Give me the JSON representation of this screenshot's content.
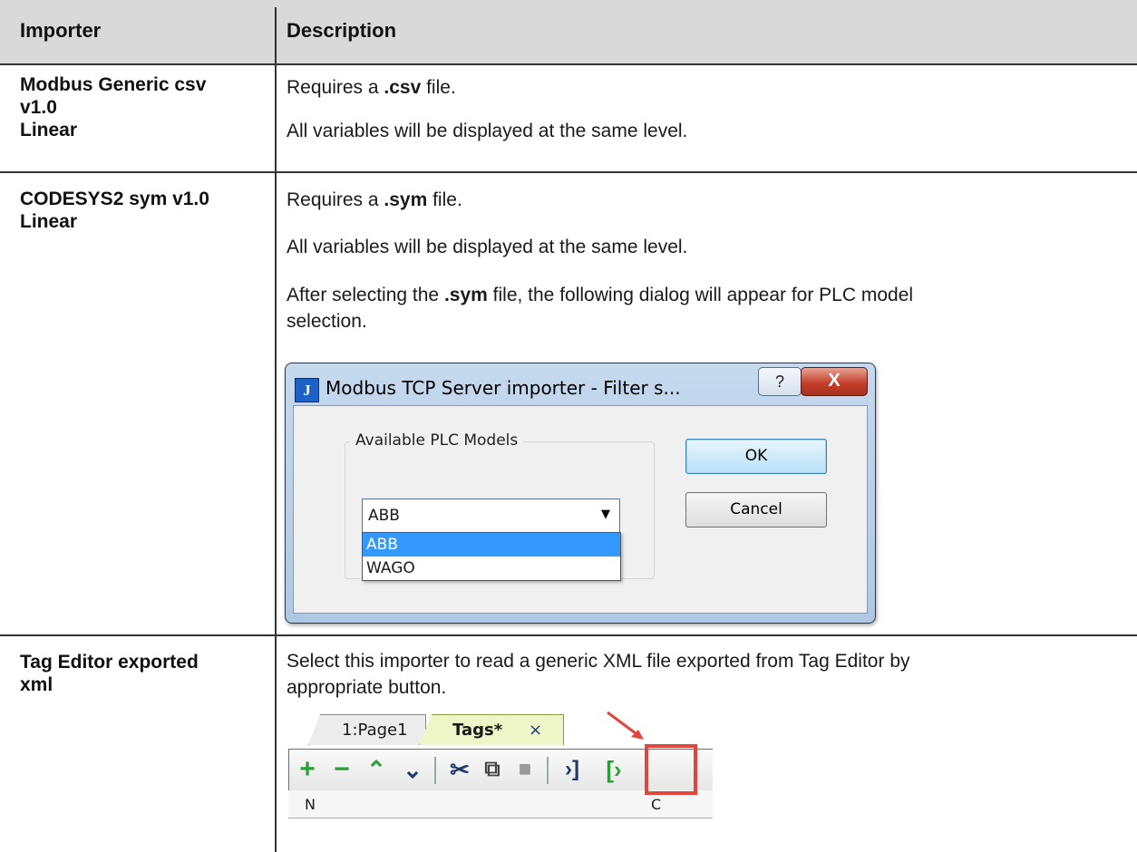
{
  "table": {
    "headers": {
      "importer": "Importer",
      "description": "Description"
    },
    "rows": [
      {
        "importer_lines": [
          "Modbus Generic csv",
          "v1.0",
          "Linear"
        ],
        "desc": [
          {
            "pre": "Requires a ",
            "bold": ".csv",
            "post": " file."
          },
          {
            "text": "All variables will be displayed at the same level."
          }
        ]
      },
      {
        "importer_lines": [
          "CODESYS2 sym v1.0",
          "Linear"
        ],
        "desc": [
          {
            "pre": "Requires a ",
            "bold": ".sym",
            "post": " file."
          },
          {
            "text": "All variables will be displayed at the same level."
          },
          {
            "pre": "After selecting the ",
            "bold": ".sym",
            "post": " file, the following dialog will appear for PLC model",
            "line2": "selection."
          }
        ]
      },
      {
        "importer_lines": [
          "Tag Editor exported",
          "xml"
        ],
        "desc": [
          {
            "text": "Select this importer to read a generic XML file exported from Tag Editor by",
            "line2": "appropriate button."
          }
        ]
      }
    ]
  },
  "dialog": {
    "icon_text": "J",
    "title": "Modbus TCP Server importer - Filter s...",
    "help_glyph": "?",
    "close_glyph": "X",
    "group_label": "Available PLC Models",
    "combo_value": "ABB",
    "dropdown_options": [
      "ABB",
      "WAGO"
    ],
    "selected_option": "ABB",
    "ok_label": "OK",
    "cancel_label": "Cancel"
  },
  "tag_editor": {
    "tabs": [
      {
        "label": "1:Page1"
      },
      {
        "label": "Tags*",
        "close": "×"
      }
    ],
    "toolbar_icons": [
      "add-icon",
      "remove-icon",
      "move-up-icon",
      "move-down-icon",
      "cut-icon",
      "copy-icon",
      "paste-icon",
      "import-icon",
      "export-icon"
    ],
    "grid_header_fragment": "N",
    "grid_header_fragment_right": "C",
    "colors": {
      "toolbar_green": "#2e9e3a",
      "toolbar_navy": "#1d3b6e",
      "highlight_red": "#e0463b"
    }
  },
  "colors": {
    "header_bg": "#d9d9d9",
    "selection": "#3399ff"
  }
}
